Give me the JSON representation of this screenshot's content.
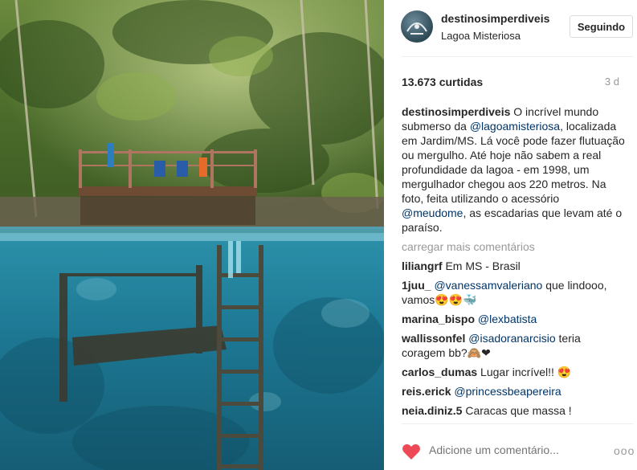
{
  "post": {
    "username": "destinosimperdiveis",
    "location": "Lagoa Misteriosa",
    "follow_label": "Seguindo",
    "likes": "13.673 curtidas",
    "time": "3 d",
    "caption_user": "destinosimperdiveis",
    "caption_parts": [
      " O incrível mundo submerso da ",
      "@lagoamisteriosa",
      ", localizada em Jardim/MS. Lá você pode fazer flutuação ou mergulho. Até hoje não sabem a real profundidade da lagoa - em 1998, um mergulhador chegou aos 220 metros. Na foto, feita utilizando o acessório ",
      "@meudome",
      ", as escadarias que levam até o paraíso."
    ]
  },
  "load_more_label": "carregar mais comentários",
  "comments": [
    {
      "user": "liliangrf",
      "text": " Em MS - Brasil",
      "mention": ""
    },
    {
      "user": "1juu_",
      "mention": "@vanessamvaleriano",
      "text": " que lindooo, vamos😍😍🐳"
    },
    {
      "user": "marina_bispo",
      "mention": "@lexbatista",
      "text": ""
    },
    {
      "user": "wallissonfel",
      "mention": "@isadoranarcisio",
      "text": " teria coragem bb?🙈❤"
    },
    {
      "user": "carlos_dumas",
      "mention": "",
      "text": " Lugar incrível!! 😍"
    },
    {
      "user": "reis.erick",
      "mention": "@princessbeapereira",
      "text": ""
    },
    {
      "user": "neia.diniz.5",
      "mention": "",
      "text": " Caracas que massa !"
    }
  ],
  "footer": {
    "comment_placeholder": "Adicione um comentário...",
    "more_label": "ooo"
  },
  "icons": {
    "heart": "heart-icon",
    "more": "more-options-icon"
  },
  "colors": {
    "heart": "#ed4956",
    "mention": "#003569",
    "water": "#1e7f9a"
  }
}
